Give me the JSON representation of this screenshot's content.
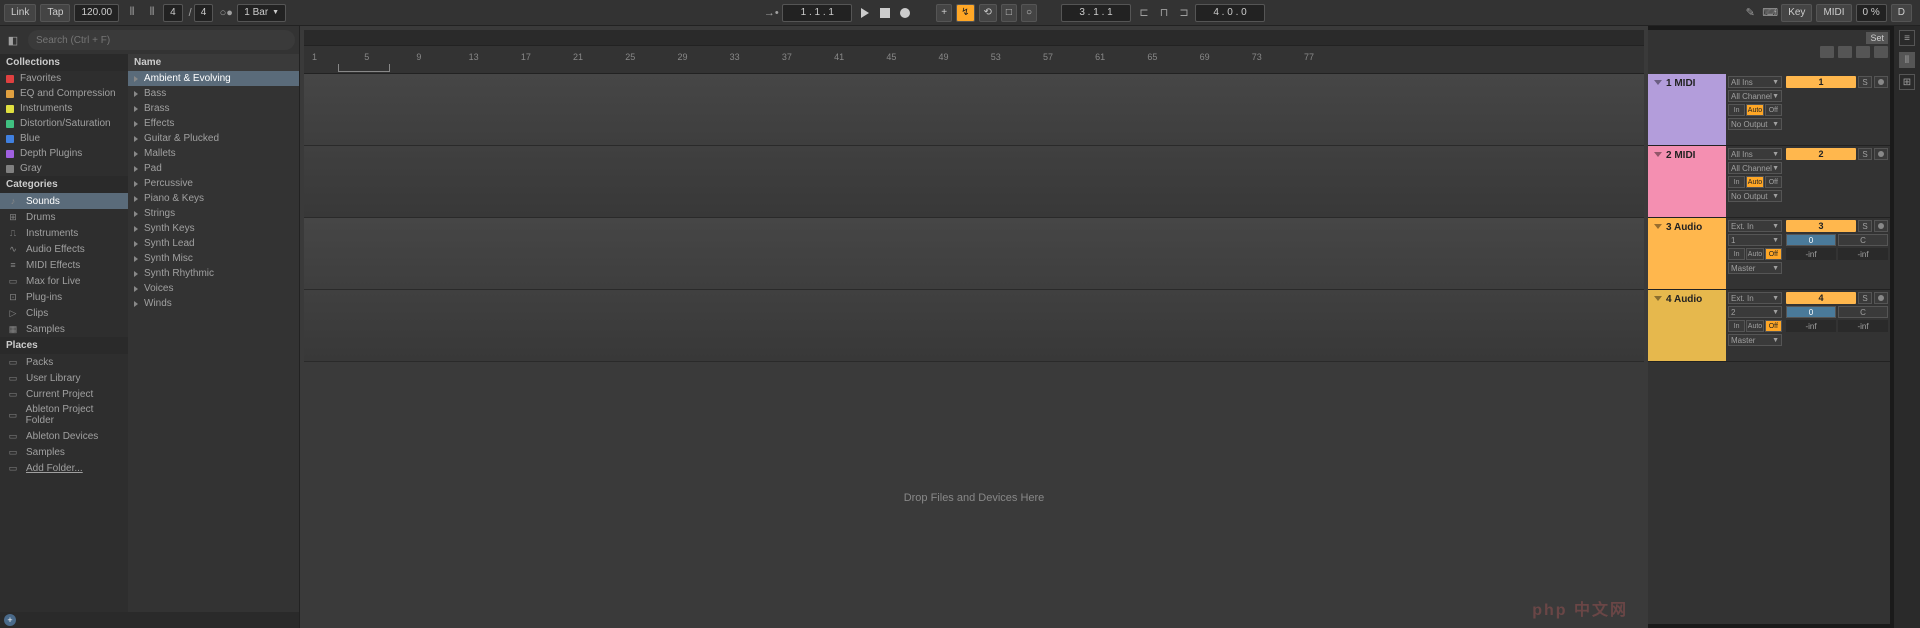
{
  "top": {
    "link": "Link",
    "tap": "Tap",
    "tempo": "120.00",
    "sig1": "4",
    "sig_sep": "/",
    "sig2": "4",
    "quant": "1 Bar",
    "pos": "1 .   1 .   1",
    "arr_pos": "3 .   1 .   1",
    "loop_len": "4 .   0 .   0",
    "pencil": "✎",
    "key": "Key",
    "midi": "MIDI",
    "cpu": "0 %",
    "overload": "D"
  },
  "browser": {
    "search_ph": "Search (Ctrl + F)",
    "collections_h": "Collections",
    "collections": [
      {
        "label": "Favorites",
        "color": "#e04040"
      },
      {
        "label": "EQ and Compression",
        "color": "#e0a040"
      },
      {
        "label": "Instruments",
        "color": "#e0e040"
      },
      {
        "label": "Distortion/Saturation",
        "color": "#40c080"
      },
      {
        "label": "Blue",
        "color": "#4080e0"
      },
      {
        "label": "Depth Plugins",
        "color": "#a060e0"
      },
      {
        "label": "Gray",
        "color": "#808080"
      }
    ],
    "categories_h": "Categories",
    "categories": [
      {
        "label": "Sounds",
        "icon": "♪",
        "sel": true
      },
      {
        "label": "Drums",
        "icon": "⊞"
      },
      {
        "label": "Instruments",
        "icon": "⎍"
      },
      {
        "label": "Audio Effects",
        "icon": "∿"
      },
      {
        "label": "MIDI Effects",
        "icon": "≡"
      },
      {
        "label": "Max for Live",
        "icon": "▭"
      },
      {
        "label": "Plug-ins",
        "icon": "⊡"
      },
      {
        "label": "Clips",
        "icon": "▷"
      },
      {
        "label": "Samples",
        "icon": "▦"
      }
    ],
    "places_h": "Places",
    "places": [
      {
        "label": "Packs"
      },
      {
        "label": "User Library"
      },
      {
        "label": "Current Project"
      },
      {
        "label": "Ableton Project Folder"
      },
      {
        "label": "Ableton Devices"
      },
      {
        "label": "Samples"
      },
      {
        "label": "Add Folder...",
        "underline": true
      }
    ],
    "name_h": "Name",
    "names": [
      {
        "label": "Ambient & Evolving",
        "sel": true
      },
      {
        "label": "Bass"
      },
      {
        "label": "Brass"
      },
      {
        "label": "Effects"
      },
      {
        "label": "Guitar & Plucked"
      },
      {
        "label": "Mallets"
      },
      {
        "label": "Pad"
      },
      {
        "label": "Percussive"
      },
      {
        "label": "Piano & Keys"
      },
      {
        "label": "Strings"
      },
      {
        "label": "Synth Keys"
      },
      {
        "label": "Synth Lead"
      },
      {
        "label": "Synth Misc"
      },
      {
        "label": "Synth Rhythmic"
      },
      {
        "label": "Voices"
      },
      {
        "label": "Winds"
      }
    ]
  },
  "ruler": [
    1,
    5,
    9,
    13,
    17,
    21,
    25,
    29,
    33,
    37,
    41,
    45,
    49,
    53,
    57,
    61,
    65,
    69,
    73,
    77
  ],
  "drop_hint": "Drop Files and Devices Here",
  "set_label": "Set",
  "tracks": [
    {
      "num": "1",
      "name": "MIDI",
      "color": "c-purple",
      "io": {
        "in": "All Ins",
        "ch": "All Channel",
        "mon": "Auto",
        "out": "No Output"
      },
      "act": "1",
      "act_bg": "#ffb74d"
    },
    {
      "num": "2",
      "name": "MIDI",
      "color": "c-pink",
      "io": {
        "in": "All Ins",
        "ch": "All Channel",
        "mon": "Auto",
        "out": "No Output"
      },
      "act": "2",
      "act_bg": "#ffb74d"
    },
    {
      "num": "3",
      "name": "Audio",
      "color": "c-orange",
      "io": {
        "in": "Ext. In",
        "ch": "1",
        "mon": "Auto",
        "mon_on": "Off",
        "out": "Master"
      },
      "act": "3",
      "act_bg": "#ffb74d",
      "sends": true,
      "send_val": "0",
      "db": "-inf"
    },
    {
      "num": "4",
      "name": "Audio",
      "color": "c-gold",
      "io": {
        "in": "Ext. In",
        "ch": "2",
        "mon": "Auto",
        "mon_on": "Off",
        "out": "Master"
      },
      "act": "4",
      "act_bg": "#ffb74d",
      "sends": true,
      "send_val": "0",
      "db": "-inf"
    }
  ],
  "io_labels": {
    "in": "In",
    "auto": "Auto",
    "off": "Off",
    "c": "C",
    "s": "S"
  },
  "watermark": "php 中文网"
}
